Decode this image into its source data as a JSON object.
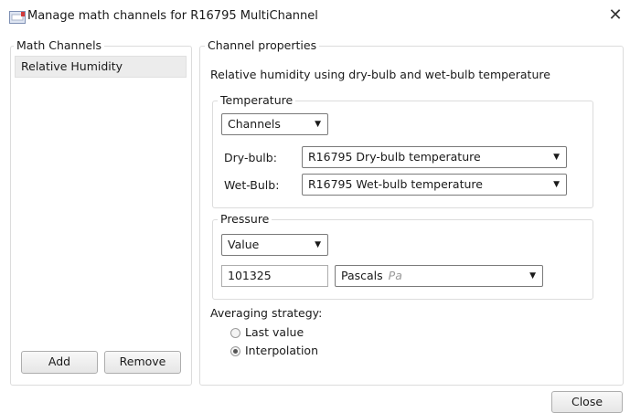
{
  "window": {
    "title": "Manage math channels for R16795 MultiChannel",
    "close_glyph": "✕"
  },
  "math_channels": {
    "legend": "Math Channels",
    "items": [
      "Relative Humidity"
    ],
    "add_label": "Add",
    "remove_label": "Remove"
  },
  "channel_properties": {
    "legend": "Channel properties",
    "description": "Relative humidity using dry-bulb and wet-bulb temperature",
    "temperature": {
      "legend": "Temperature",
      "source_selected": "Channels",
      "dry_bulb_label": "Dry-bulb:",
      "dry_bulb_value": "R16795 Dry-bulb temperature",
      "wet_bulb_label": "Wet-Bulb:",
      "wet_bulb_value": "R16795 Wet-bulb temperature"
    },
    "pressure": {
      "legend": "Pressure",
      "source_selected": "Value",
      "value": "101325",
      "unit_name": "Pascals",
      "unit_symbol": "Pa"
    },
    "averaging": {
      "label": "Averaging strategy:",
      "options": [
        "Last value",
        "Interpolation"
      ],
      "selected": "Interpolation"
    }
  },
  "footer": {
    "close_label": "Close"
  },
  "icons": {
    "dropdown_arrow": "▼"
  }
}
